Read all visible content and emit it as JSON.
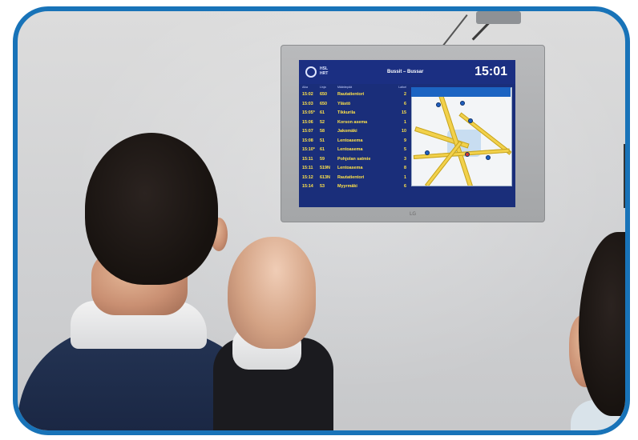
{
  "display": {
    "brand_line1": "HSL",
    "brand_line2": "HRT",
    "stop_name": "Bussit – Bussar",
    "clock": "15:01",
    "manufacturer": "LG",
    "columns": [
      "Aika",
      "Linja",
      "Määränpää",
      "Laituri"
    ],
    "departures": [
      {
        "time": "15:02",
        "line": "650",
        "dest": "Rautatientori",
        "plat": "2"
      },
      {
        "time": "15:03",
        "line": "650",
        "dest": "Ylästö",
        "plat": "6"
      },
      {
        "time": "15:05*",
        "line": "61",
        "dest": "Tikkurila",
        "plat": "15"
      },
      {
        "time": "15:06",
        "line": "52",
        "dest": "Korson asema",
        "plat": "1"
      },
      {
        "time": "15:07",
        "line": "58",
        "dest": "Jakomäki",
        "plat": "10"
      },
      {
        "time": "15:08",
        "line": "51",
        "dest": "Lentoasema",
        "plat": "9"
      },
      {
        "time": "15:10*",
        "line": "61",
        "dest": "Lentoasema",
        "plat": "5"
      },
      {
        "time": "15:11",
        "line": "59",
        "dest": "Pohjolan satmie",
        "plat": "3"
      },
      {
        "time": "15:11",
        "line": "519N",
        "dest": "Lentoasema",
        "plat": "8"
      },
      {
        "time": "15:12",
        "line": "613N",
        "dest": "Rautatientori",
        "plat": "1"
      },
      {
        "time": "15:14",
        "line": "53",
        "dest": "Myyrmäki",
        "plat": "6"
      }
    ]
  },
  "colors": {
    "frame_border": "#1873b8",
    "screen_bg": "#1a2e7a",
    "departure_text": "#ffe34a"
  }
}
